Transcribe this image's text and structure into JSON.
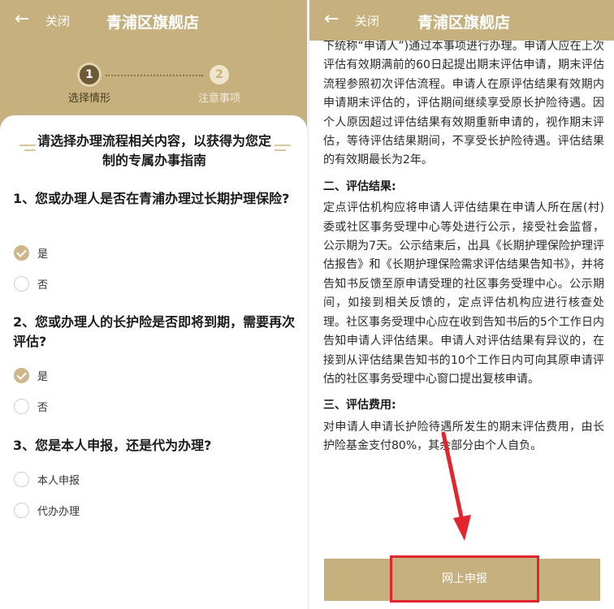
{
  "header": {
    "back_icon": "arrow-left-icon",
    "close_label": "关闭",
    "title": "青浦区旗舰店"
  },
  "steps": [
    {
      "number": "1",
      "label": "选择情形"
    },
    {
      "number": "2",
      "label": "注意事项"
    }
  ],
  "left": {
    "heading": "请选择办理流程相关内容，以获得为您定制的专属办事指南",
    "questions": [
      {
        "text": "1、您或办理人是否在青浦办理过长期护理保险?",
        "options": [
          {
            "label": "是",
            "checked": true
          },
          {
            "label": "否",
            "checked": false
          }
        ]
      },
      {
        "text": "2、您或办理人的长护险是否即将到期，需要再次评估?",
        "options": [
          {
            "label": "是",
            "checked": true
          },
          {
            "label": "否",
            "checked": false
          }
        ]
      },
      {
        "text": "3、您是本人申报，还是代为办理?",
        "options": [
          {
            "label": "本人申报",
            "checked": false
          },
          {
            "label": "代办办理",
            "checked": false
          }
        ]
      }
    ]
  },
  "right": {
    "paragraph1": "下统称“申请人”)通过本事项进行办理。申请人应在上次评估有效期满前的60日起提出期末评估申请，期末评估流程参照初次评估流程。申请人在原评估结果有效期内申请期末评估的，评估期间继续享受原长护险待遇。因个人原因超过评估结果有效期重新申请的，视作期末评估，等待评估结果期间，不享受长护险待遇。评估结果的有效期最长为2年。",
    "section2_title": "二、评估结果:",
    "paragraph2": "定点评估机构应将申请人评估结果在申请人所在居(村)委或社区事务受理中心等处进行公示，接受社会监督，公示期为7天。公示结束后，出具《长期护理保险护理评估报告》和《长期护理保险需求评估结果告知书》，并将告知书反馈至原申请受理的社区事务受理中心。公示期间，如接到相关反馈的，定点评估机构应进行核查处理。社区事务受理中心应在收到告知书后的5个工作日内告知申请人评估结果。申请人对评估结果有异议的，在接到从评估结果告知书的10个工作日内可向其原申请评估的社区事务受理中心窗口提出复核申请。",
    "section3_title": "三、评估费用:",
    "paragraph3": "对申请人申请长护险待遇所发生的期末评估费用，由长护险基金支付80%，其余部分由个人自负。",
    "apply_button_label": "网上申报"
  },
  "colors": {
    "brand": "#c5b07e",
    "highlight": "#e2262e"
  }
}
